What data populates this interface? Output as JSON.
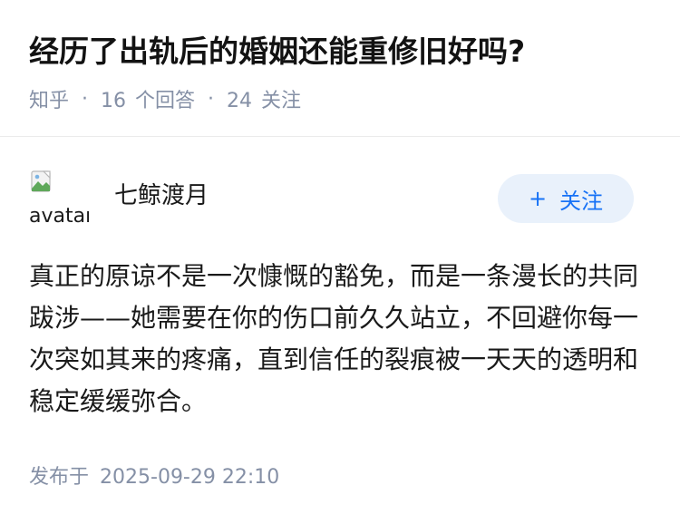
{
  "question": {
    "title": "经历了出轨后的婚姻还能重修旧好吗?",
    "source": "知乎",
    "separator": "·",
    "answer_count": "16",
    "answer_count_label": "个回答",
    "follower_count": "24",
    "follower_count_label": "关注"
  },
  "answer": {
    "author": {
      "avatar_alt": "avatar",
      "name": "七鲸渡月",
      "follow_label": "关注",
      "follow_icon": "plus-icon"
    },
    "content": "真正的原谅不是一次慷慨的豁免，而是一条漫长的共同跋涉——她需要在你的伤口前久久站立，不回避你每一次突如其来的疼痛，直到信任的裂痕被一天天的透明和稳定缓缓弥合。",
    "publish_label": "发布于",
    "publish_time": "2025-09-29 22:10"
  },
  "colors": {
    "meta_gray": "#8590a6",
    "follow_bg": "#e9f1fb",
    "follow_text": "#1772f6",
    "divider": "#ebebeb"
  }
}
